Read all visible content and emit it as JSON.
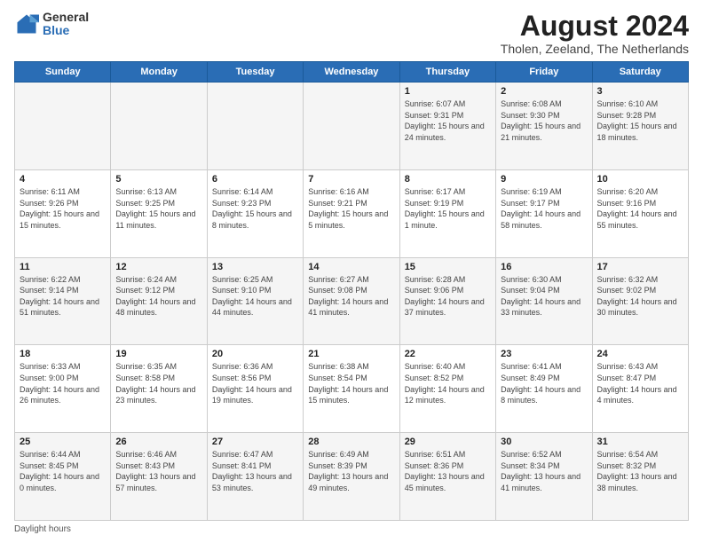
{
  "logo": {
    "general": "General",
    "blue": "Blue"
  },
  "title": "August 2024",
  "subtitle": "Tholen, Zeeland, The Netherlands",
  "days_of_week": [
    "Sunday",
    "Monday",
    "Tuesday",
    "Wednesday",
    "Thursday",
    "Friday",
    "Saturday"
  ],
  "footer": "Daylight hours",
  "weeks": [
    [
      {
        "day": "",
        "info": ""
      },
      {
        "day": "",
        "info": ""
      },
      {
        "day": "",
        "info": ""
      },
      {
        "day": "",
        "info": ""
      },
      {
        "day": "1",
        "info": "Sunrise: 6:07 AM\nSunset: 9:31 PM\nDaylight: 15 hours\nand 24 minutes."
      },
      {
        "day": "2",
        "info": "Sunrise: 6:08 AM\nSunset: 9:30 PM\nDaylight: 15 hours\nand 21 minutes."
      },
      {
        "day": "3",
        "info": "Sunrise: 6:10 AM\nSunset: 9:28 PM\nDaylight: 15 hours\nand 18 minutes."
      }
    ],
    [
      {
        "day": "4",
        "info": "Sunrise: 6:11 AM\nSunset: 9:26 PM\nDaylight: 15 hours\nand 15 minutes."
      },
      {
        "day": "5",
        "info": "Sunrise: 6:13 AM\nSunset: 9:25 PM\nDaylight: 15 hours\nand 11 minutes."
      },
      {
        "day": "6",
        "info": "Sunrise: 6:14 AM\nSunset: 9:23 PM\nDaylight: 15 hours\nand 8 minutes."
      },
      {
        "day": "7",
        "info": "Sunrise: 6:16 AM\nSunset: 9:21 PM\nDaylight: 15 hours\nand 5 minutes."
      },
      {
        "day": "8",
        "info": "Sunrise: 6:17 AM\nSunset: 9:19 PM\nDaylight: 15 hours\nand 1 minute."
      },
      {
        "day": "9",
        "info": "Sunrise: 6:19 AM\nSunset: 9:17 PM\nDaylight: 14 hours\nand 58 minutes."
      },
      {
        "day": "10",
        "info": "Sunrise: 6:20 AM\nSunset: 9:16 PM\nDaylight: 14 hours\nand 55 minutes."
      }
    ],
    [
      {
        "day": "11",
        "info": "Sunrise: 6:22 AM\nSunset: 9:14 PM\nDaylight: 14 hours\nand 51 minutes."
      },
      {
        "day": "12",
        "info": "Sunrise: 6:24 AM\nSunset: 9:12 PM\nDaylight: 14 hours\nand 48 minutes."
      },
      {
        "day": "13",
        "info": "Sunrise: 6:25 AM\nSunset: 9:10 PM\nDaylight: 14 hours\nand 44 minutes."
      },
      {
        "day": "14",
        "info": "Sunrise: 6:27 AM\nSunset: 9:08 PM\nDaylight: 14 hours\nand 41 minutes."
      },
      {
        "day": "15",
        "info": "Sunrise: 6:28 AM\nSunset: 9:06 PM\nDaylight: 14 hours\nand 37 minutes."
      },
      {
        "day": "16",
        "info": "Sunrise: 6:30 AM\nSunset: 9:04 PM\nDaylight: 14 hours\nand 33 minutes."
      },
      {
        "day": "17",
        "info": "Sunrise: 6:32 AM\nSunset: 9:02 PM\nDaylight: 14 hours\nand 30 minutes."
      }
    ],
    [
      {
        "day": "18",
        "info": "Sunrise: 6:33 AM\nSunset: 9:00 PM\nDaylight: 14 hours\nand 26 minutes."
      },
      {
        "day": "19",
        "info": "Sunrise: 6:35 AM\nSunset: 8:58 PM\nDaylight: 14 hours\nand 23 minutes."
      },
      {
        "day": "20",
        "info": "Sunrise: 6:36 AM\nSunset: 8:56 PM\nDaylight: 14 hours\nand 19 minutes."
      },
      {
        "day": "21",
        "info": "Sunrise: 6:38 AM\nSunset: 8:54 PM\nDaylight: 14 hours\nand 15 minutes."
      },
      {
        "day": "22",
        "info": "Sunrise: 6:40 AM\nSunset: 8:52 PM\nDaylight: 14 hours\nand 12 minutes."
      },
      {
        "day": "23",
        "info": "Sunrise: 6:41 AM\nSunset: 8:49 PM\nDaylight: 14 hours\nand 8 minutes."
      },
      {
        "day": "24",
        "info": "Sunrise: 6:43 AM\nSunset: 8:47 PM\nDaylight: 14 hours\nand 4 minutes."
      }
    ],
    [
      {
        "day": "25",
        "info": "Sunrise: 6:44 AM\nSunset: 8:45 PM\nDaylight: 14 hours\nand 0 minutes."
      },
      {
        "day": "26",
        "info": "Sunrise: 6:46 AM\nSunset: 8:43 PM\nDaylight: 13 hours\nand 57 minutes."
      },
      {
        "day": "27",
        "info": "Sunrise: 6:47 AM\nSunset: 8:41 PM\nDaylight: 13 hours\nand 53 minutes."
      },
      {
        "day": "28",
        "info": "Sunrise: 6:49 AM\nSunset: 8:39 PM\nDaylight: 13 hours\nand 49 minutes."
      },
      {
        "day": "29",
        "info": "Sunrise: 6:51 AM\nSunset: 8:36 PM\nDaylight: 13 hours\nand 45 minutes."
      },
      {
        "day": "30",
        "info": "Sunrise: 6:52 AM\nSunset: 8:34 PM\nDaylight: 13 hours\nand 41 minutes."
      },
      {
        "day": "31",
        "info": "Sunrise: 6:54 AM\nSunset: 8:32 PM\nDaylight: 13 hours\nand 38 minutes."
      }
    ]
  ]
}
